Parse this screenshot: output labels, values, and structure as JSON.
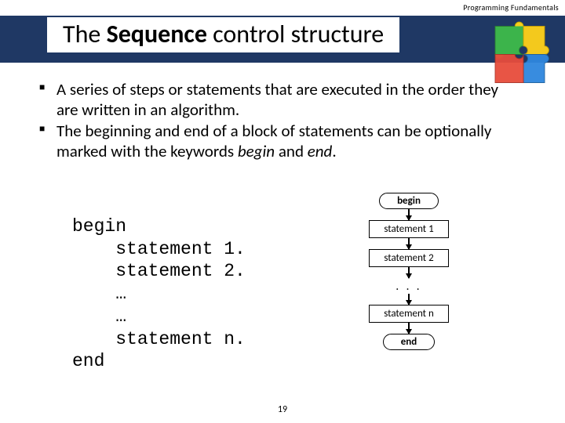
{
  "course_label": "Programming Fundamentals",
  "title": {
    "pre": "The ",
    "bold": "Sequence",
    "post": " control structure"
  },
  "bullets": [
    {
      "text_a": "A series of steps or statements that are executed in the order they are written in an algorithm."
    },
    {
      "text_a": "The beginning and end of a block of statements can be optionally marked with the keywords ",
      "italic1": "begin",
      "text_b": " and ",
      "italic2": "end",
      "text_c": "."
    }
  ],
  "code": {
    "l1": "begin",
    "l2": "    statement 1.",
    "l3": "    statement 2.",
    "l4": "    …",
    "l5": "    …",
    "l6": "    statement n.",
    "l7": "end"
  },
  "flow": {
    "begin": "begin",
    "s1": "statement 1",
    "s2": "statement 2",
    "dots": ". . .",
    "sn": "statement n",
    "end": "end"
  },
  "page_number": "19"
}
